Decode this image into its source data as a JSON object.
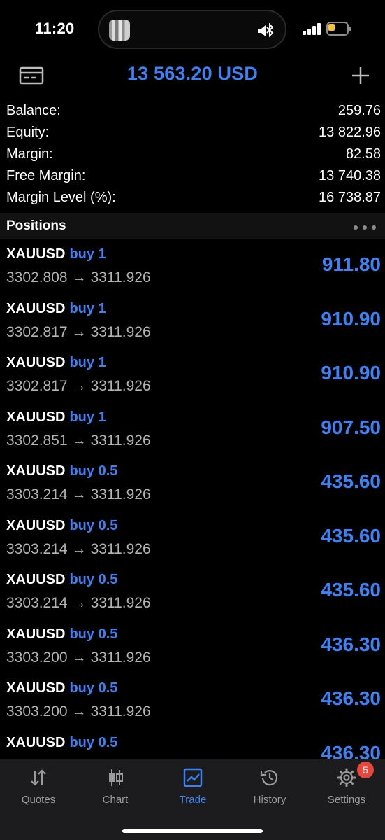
{
  "status_bar": {
    "time": "11:20",
    "icons": [
      "media-thumbnail",
      "speaker-icon",
      "bluetooth-icon",
      "cellular-signal-icon",
      "battery-icon"
    ],
    "battery_color": "#f6c330"
  },
  "header": {
    "title": "13 563.20 USD",
    "left_icon": "account-card-icon",
    "right_icon": "plus-icon",
    "accent_color": "#3b82f6"
  },
  "summary": [
    {
      "label": "Balance:",
      "value": "259.76"
    },
    {
      "label": "Equity:",
      "value": "13 822.96"
    },
    {
      "label": "Margin:",
      "value": "82.58"
    },
    {
      "label": "Free Margin:",
      "value": "13 740.38"
    },
    {
      "label": "Margin Level (%):",
      "value": "16 738.87"
    }
  ],
  "positions_section": {
    "title": "Positions",
    "more_icon": "more-horizontal-icon"
  },
  "positions": [
    {
      "symbol": "XAUUSD",
      "side": "buy 1",
      "open": "3302.808",
      "arrow": "→",
      "current": "3311.926",
      "profit": "911.80"
    },
    {
      "symbol": "XAUUSD",
      "side": "buy 1",
      "open": "3302.817",
      "arrow": "→",
      "current": "3311.926",
      "profit": "910.90"
    },
    {
      "symbol": "XAUUSD",
      "side": "buy 1",
      "open": "3302.817",
      "arrow": "→",
      "current": "3311.926",
      "profit": "910.90"
    },
    {
      "symbol": "XAUUSD",
      "side": "buy 1",
      "open": "3302.851",
      "arrow": "→",
      "current": "3311.926",
      "profit": "907.50"
    },
    {
      "symbol": "XAUUSD",
      "side": "buy 0.5",
      "open": "3303.214",
      "arrow": "→",
      "current": "3311.926",
      "profit": "435.60"
    },
    {
      "symbol": "XAUUSD",
      "side": "buy 0.5",
      "open": "3303.214",
      "arrow": "→",
      "current": "3311.926",
      "profit": "435.60"
    },
    {
      "symbol": "XAUUSD",
      "side": "buy 0.5",
      "open": "3303.214",
      "arrow": "→",
      "current": "3311.926",
      "profit": "435.60"
    },
    {
      "symbol": "XAUUSD",
      "side": "buy 0.5",
      "open": "3303.200",
      "arrow": "→",
      "current": "3311.926",
      "profit": "436.30"
    },
    {
      "symbol": "XAUUSD",
      "side": "buy 0.5",
      "open": "3303.200",
      "arrow": "→",
      "current": "3311.926",
      "profit": "436.30"
    },
    {
      "symbol": "XAUUSD",
      "side": "buy 0.5",
      "open": "",
      "arrow": "",
      "current": "",
      "profit": "436.30"
    }
  ],
  "tabs": [
    {
      "label": "Quotes",
      "icon": "quotes-icon"
    },
    {
      "label": "Chart",
      "icon": "candlestick-chart-icon"
    },
    {
      "label": "Trade",
      "icon": "trade-chart-icon",
      "active": true
    },
    {
      "label": "History",
      "icon": "history-clock-icon"
    },
    {
      "label": "Settings",
      "icon": "settings-gear-icon",
      "badge": "5"
    }
  ]
}
